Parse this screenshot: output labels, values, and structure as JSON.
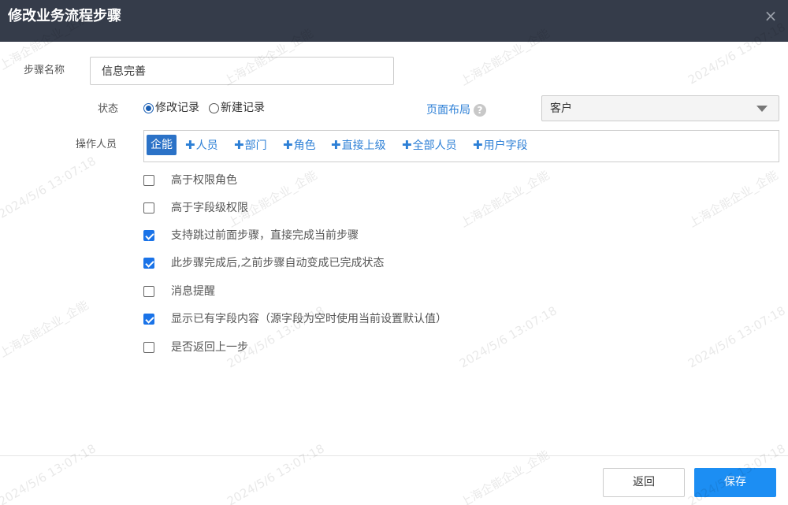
{
  "dialog": {
    "title": "修改业务流程步骤",
    "close_icon": "×"
  },
  "form": {
    "step_name_label": "步骤名称",
    "step_name_value": "信息完善",
    "status_label": "状态",
    "status_options": [
      {
        "label": "修改记录",
        "selected": true
      },
      {
        "label": "新建记录",
        "selected": false
      }
    ],
    "layout_label": "页面布局",
    "layout_help_icon": "?",
    "layout_value": "客户",
    "operators_label": "操作人员",
    "operator_tag": "企能",
    "operator_links": [
      "人员",
      "部门",
      "角色",
      "直接上级",
      "全部人员",
      "用户字段"
    ],
    "plus_icon": "✚",
    "options": [
      {
        "label": "高于权限角色",
        "checked": false
      },
      {
        "label": "高于字段级权限",
        "checked": false
      },
      {
        "label": "支持跳过前面步骤，直接完成当前步骤",
        "checked": true
      },
      {
        "label": "此步骤完成后,之前步骤自动变成已完成状态",
        "checked": true
      },
      {
        "label": "消息提醒",
        "checked": false
      },
      {
        "label": "显示已有字段内容（源字段为空时使用当前设置默认值）",
        "checked": true
      },
      {
        "label": "是否返回上一步",
        "checked": false
      }
    ]
  },
  "footer": {
    "back_label": "返回",
    "save_label": "保存"
  },
  "watermark": {
    "company": "上海企能企业_企能",
    "timestamp": "2024/5/6 13:07:18"
  },
  "colors": {
    "header_bg": "#353c4a",
    "accent": "#2c7fd6",
    "primary_button": "#1c8ef3",
    "tag_bg": "#2b72c7"
  }
}
